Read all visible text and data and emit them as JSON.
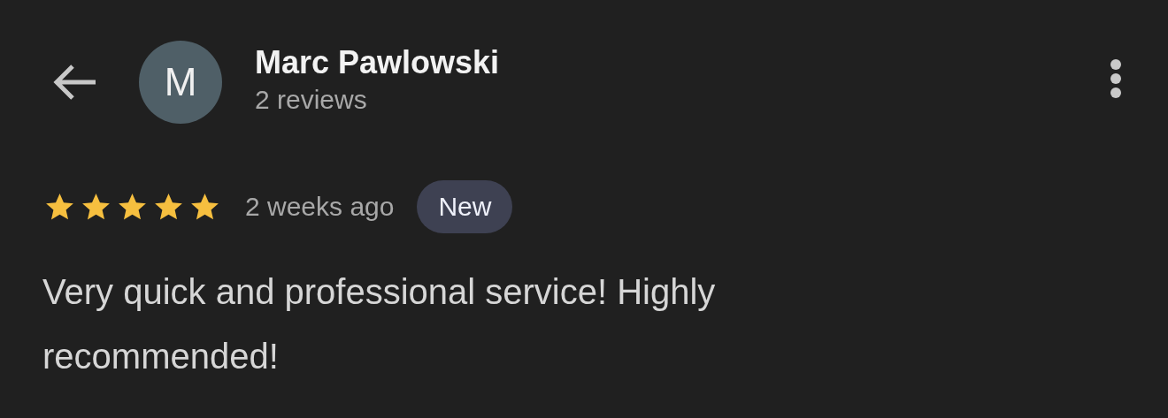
{
  "reviewer": {
    "initial": "M",
    "name": "Marc Pawlowski",
    "review_count": "2 reviews"
  },
  "review": {
    "stars": 5,
    "time": "2 weeks ago",
    "badge": "New",
    "text": "Very quick and professional service! Highly recommended!"
  }
}
